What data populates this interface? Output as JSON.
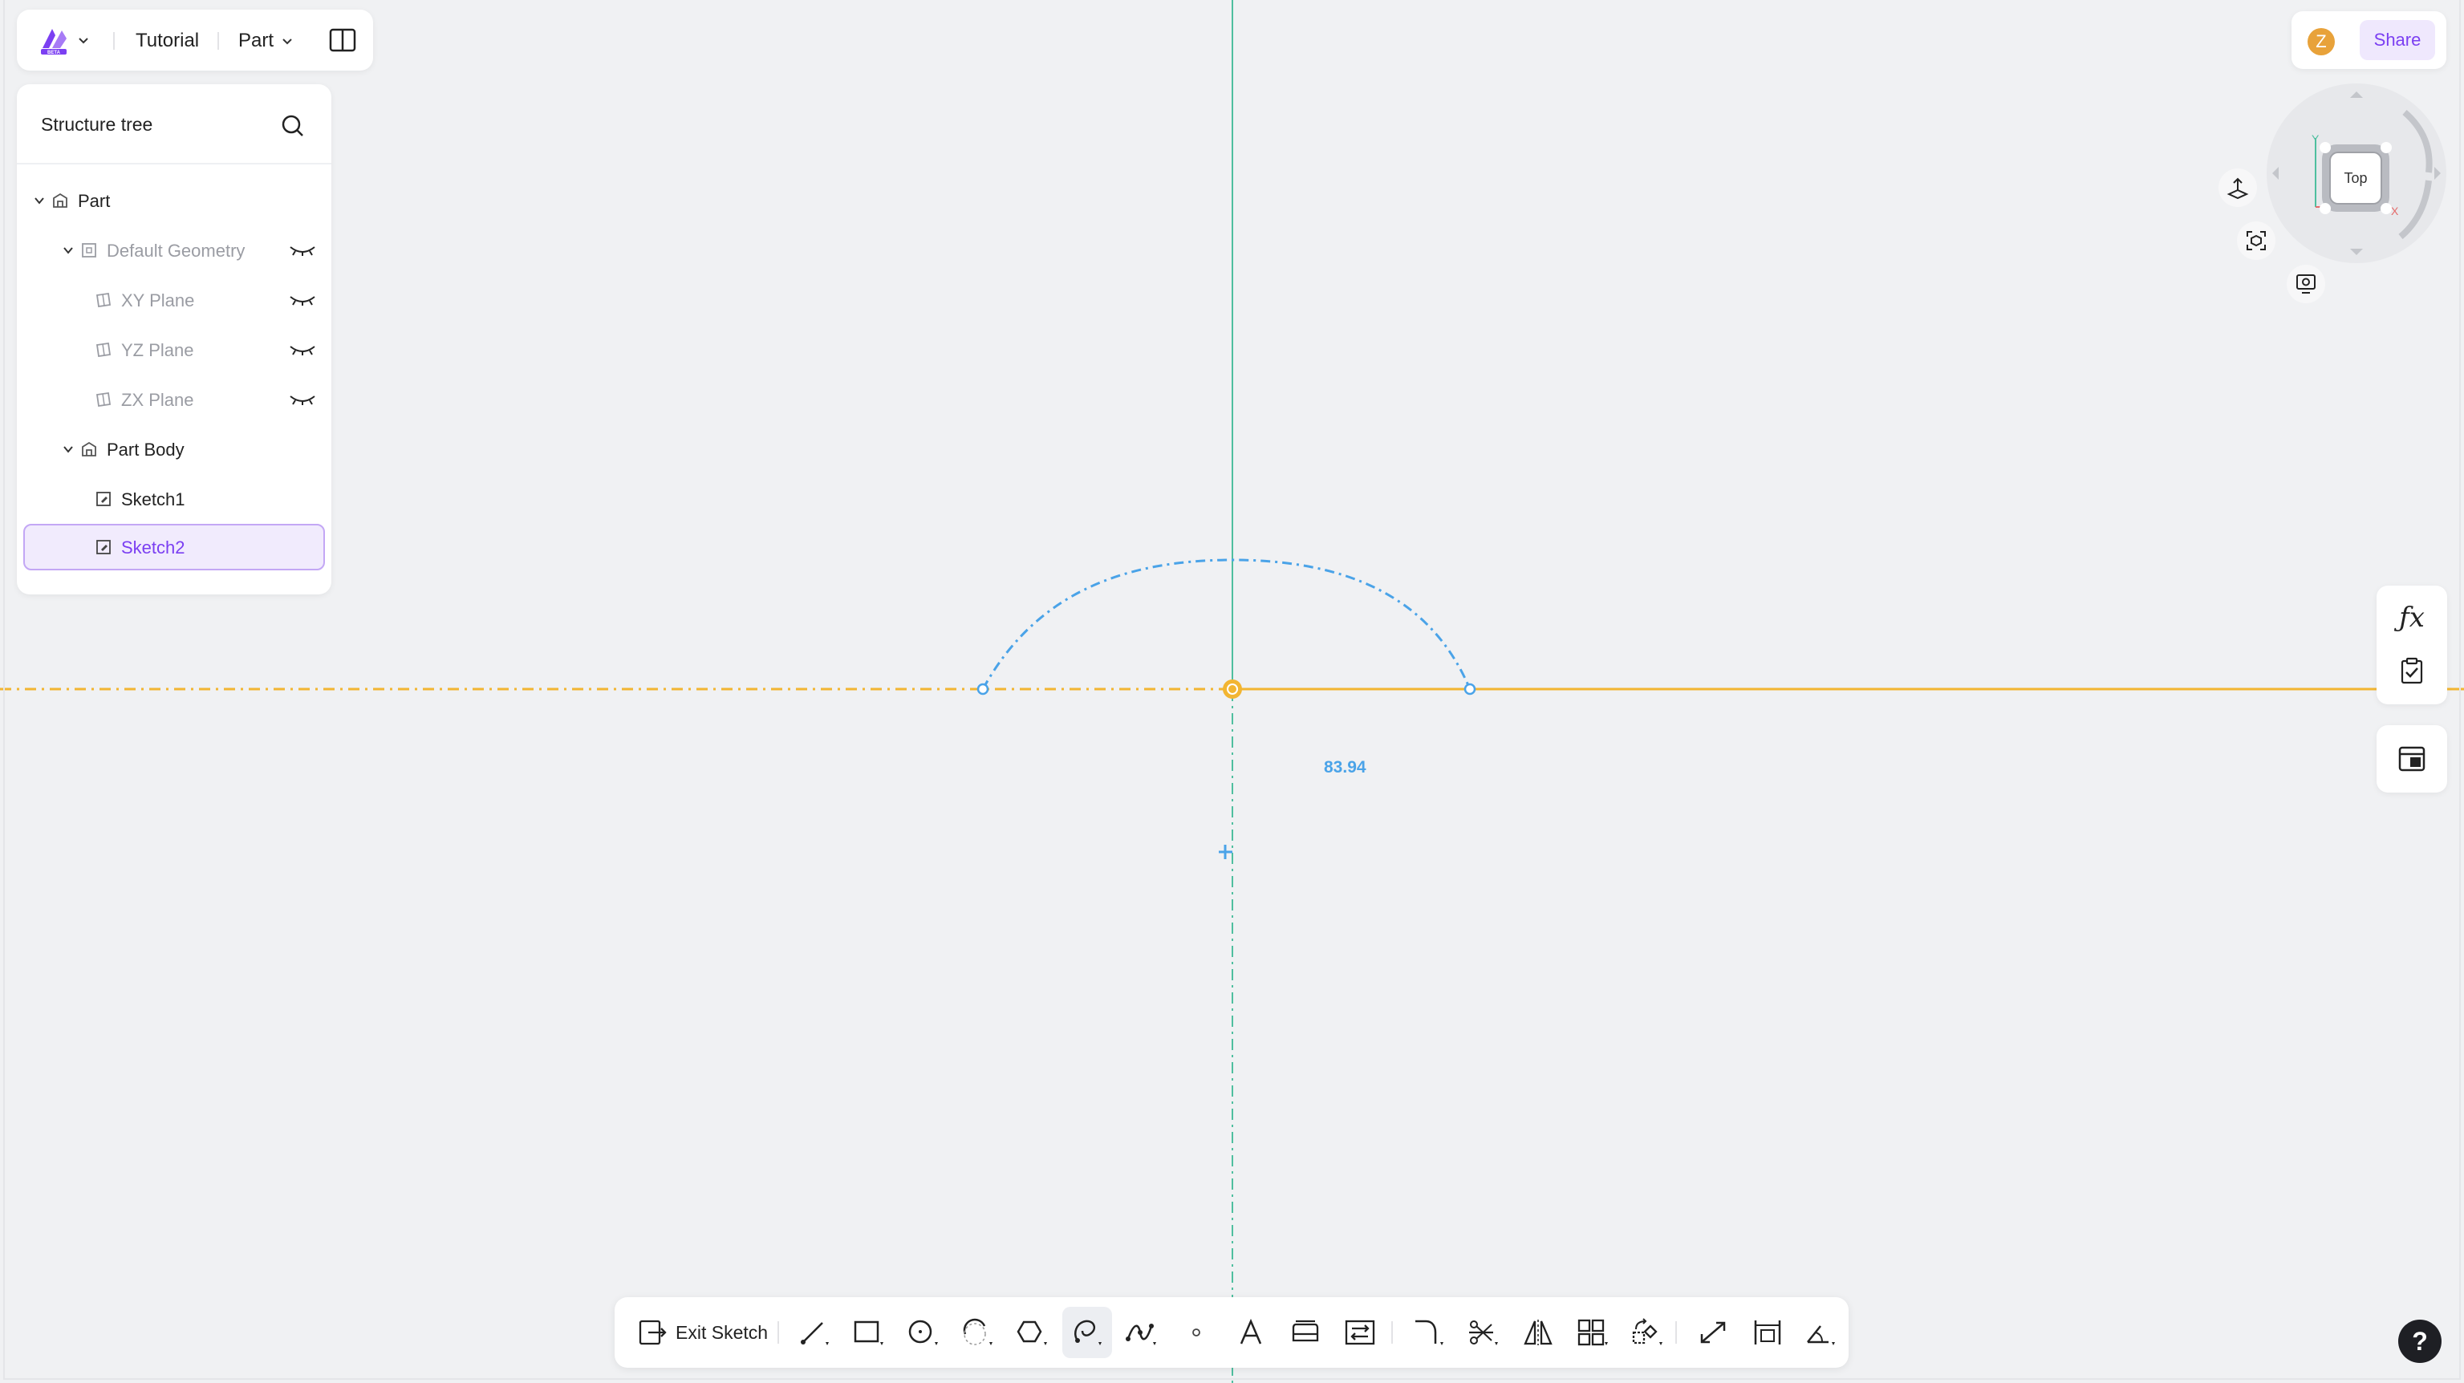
{
  "topbar": {
    "tutorial_label": "Tutorial",
    "mode_label": "Part"
  },
  "tree": {
    "title": "Structure tree",
    "items": [
      {
        "label": "Part"
      },
      {
        "label": "Default Geometry"
      },
      {
        "label": "XY Plane"
      },
      {
        "label": "YZ Plane"
      },
      {
        "label": "ZX Plane"
      },
      {
        "label": "Part Body"
      },
      {
        "label": "Sketch1"
      },
      {
        "label": "Sketch2"
      }
    ]
  },
  "header_right": {
    "avatar_initial": "Z",
    "share_label": "Share"
  },
  "viewcube": {
    "face_label": "Top",
    "axis_y": "Y",
    "axis_x": "X"
  },
  "canvas": {
    "dimension_value": "83.94"
  },
  "toolbar": {
    "exit_label": "Exit Sketch",
    "tools": [
      "line-icon",
      "rectangle-icon",
      "circle-icon",
      "arc-icon",
      "polygon-icon",
      "slot-icon",
      "spline-icon",
      "point-icon",
      "text-icon",
      "offset-icon",
      "project-icon",
      "fillet-icon",
      "trim-icon",
      "mirror-icon",
      "pattern-icon",
      "transform-icon",
      "constraint-icon",
      "dimension-icon",
      "angle-icon"
    ]
  },
  "colors": {
    "accent": "#7b3ff2",
    "axis_vertical": "#4fbf9f",
    "axis_horizontal": "#f2b532",
    "sketch_blue": "#4aa3e8"
  },
  "help_label": "?"
}
